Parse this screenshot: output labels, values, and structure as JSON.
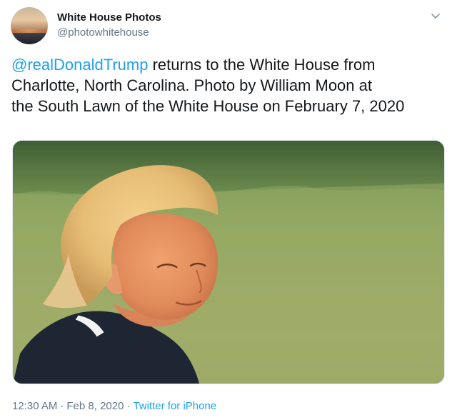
{
  "tweet": {
    "author": {
      "display_name": "White House Photos",
      "handle": "@photowhitehouse"
    },
    "text": {
      "mention": "@realDonaldTrump",
      "line1_rest": " returns to the White House from",
      "line2": "Charlotte, North Carolina. Photo by William Moon at",
      "line3": "the South Lawn of the White House on February 7, 2020"
    },
    "media": {
      "icon": "photo-image"
    },
    "meta": {
      "time": "12:30 AM",
      "separator1": "·",
      "date": "Feb 8, 2020",
      "separator2": "·",
      "source": "Twitter for iPhone"
    }
  },
  "colors": {
    "link": "#1da1f2",
    "text": "#14171a",
    "secondary": "#657786"
  }
}
